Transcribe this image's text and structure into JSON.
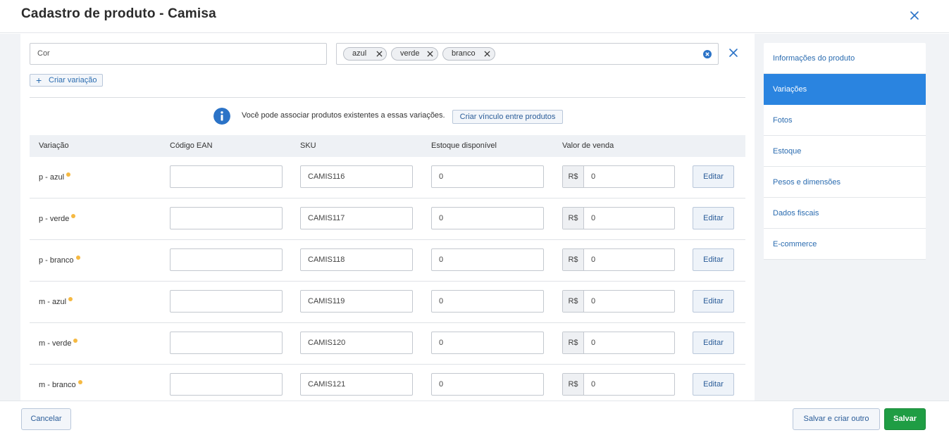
{
  "header": {
    "title": "Cadastro de produto - Camisa"
  },
  "attribute": {
    "name_value": "Cor",
    "tags": [
      {
        "label": "azul"
      },
      {
        "label": "verde"
      },
      {
        "label": "branco"
      }
    ]
  },
  "create_variation_label": "Criar variação",
  "info": {
    "text": "Você pode associar produtos existentes a essas variações.",
    "link_label": "Criar vínculo entre produtos"
  },
  "table": {
    "headers": {
      "variation": "Variação",
      "ean": "Código EAN",
      "sku": "SKU",
      "stock": "Estoque disponível",
      "price": "Valor de venda"
    },
    "currency": "R$",
    "edit_label": "Editar",
    "rows": [
      {
        "name": "p - azul",
        "ean": "",
        "sku": "CAMIS116",
        "stock": "0",
        "price": "0"
      },
      {
        "name": "p - verde",
        "ean": "",
        "sku": "CAMIS117",
        "stock": "0",
        "price": "0"
      },
      {
        "name": "p - branco",
        "ean": "",
        "sku": "CAMIS118",
        "stock": "0",
        "price": "0"
      },
      {
        "name": "m - azul",
        "ean": "",
        "sku": "CAMIS119",
        "stock": "0",
        "price": "0"
      },
      {
        "name": "m - verde",
        "ean": "",
        "sku": "CAMIS120",
        "stock": "0",
        "price": "0"
      },
      {
        "name": "m - branco",
        "ean": "",
        "sku": "CAMIS121",
        "stock": "0",
        "price": "0"
      }
    ]
  },
  "sidebar": {
    "items": [
      {
        "label": "Informações do produto",
        "active": false
      },
      {
        "label": "Variações",
        "active": true
      },
      {
        "label": "Fotos",
        "active": false
      },
      {
        "label": "Estoque",
        "active": false
      },
      {
        "label": "Pesos e dimensões",
        "active": false
      },
      {
        "label": "Dados fiscais",
        "active": false
      },
      {
        "label": "E-commerce",
        "active": false
      }
    ]
  },
  "footer": {
    "cancel_label": "Cancelar",
    "save_new_label": "Salvar e criar outro",
    "save_label": "Salvar"
  },
  "colors": {
    "accent": "#2a84e0",
    "link": "#2b6cb0",
    "save_green": "#1f9d44",
    "status_dot": "#f5b942"
  },
  "icons": {
    "close": "close-icon",
    "tag_remove": "x-icon",
    "clear": "clear-circle-icon",
    "info": "info-icon",
    "plus": "plus-icon"
  }
}
